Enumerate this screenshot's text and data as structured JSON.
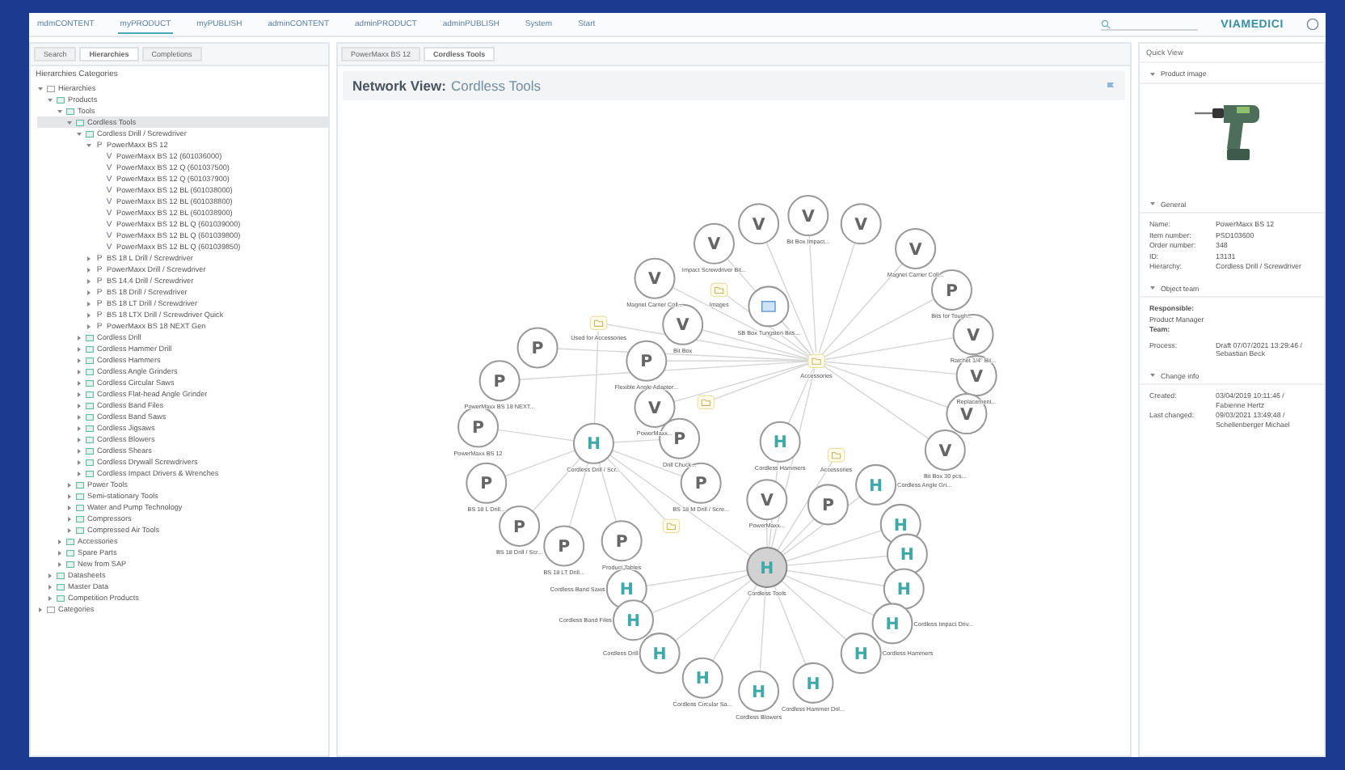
{
  "nav": {
    "items": [
      {
        "label": "mdmCONTENT",
        "selected": false
      },
      {
        "label": "myPRODUCT",
        "selected": true
      },
      {
        "label": "myPUBLISH",
        "selected": false
      },
      {
        "label": "adminCONTENT",
        "selected": false
      },
      {
        "label": "adminPRODUCT",
        "selected": false
      },
      {
        "label": "adminPUBLISH",
        "selected": false
      },
      {
        "label": "System",
        "selected": false
      },
      {
        "label": "Start",
        "selected": false
      }
    ],
    "logo": "VIAMEDICI"
  },
  "left_panel": {
    "tabs": [
      {
        "label": "Search",
        "selected": false
      },
      {
        "label": "Hierarchies",
        "selected": true
      },
      {
        "label": "Completions",
        "selected": false
      }
    ],
    "heading": "Hierarchies Categories",
    "tree": [
      {
        "label": "Hierarchies",
        "kind": "root",
        "expanded": true,
        "selected": false,
        "children": [
          {
            "label": "Products",
            "kind": "hierarchy",
            "expanded": true,
            "selected": false,
            "children": [
              {
                "label": "Tools",
                "kind": "hierarchy",
                "expanded": true,
                "selected": false,
                "children": [
                  {
                    "label": "Cordless Tools",
                    "kind": "hierarchy",
                    "expanded": true,
                    "selected": true,
                    "children": [
                      {
                        "label": "Cordless Drill / Screwdriver",
                        "kind": "hierarchy",
                        "expanded": true,
                        "selected": false,
                        "children": [
                          {
                            "label": "PowerMaxx BS 12",
                            "kind": "product",
                            "icon": "P",
                            "expanded": true,
                            "selected": false,
                            "children": [
                              {
                                "label": "PowerMaxx BS 12 (601036000)",
                                "kind": "variant",
                                "icon": "V",
                                "selected": false
                              },
                              {
                                "label": "PowerMaxx BS 12 Q (601037500)",
                                "kind": "variant",
                                "icon": "V",
                                "selected": false
                              },
                              {
                                "label": "PowerMaxx BS 12 Q (601037900)",
                                "kind": "variant",
                                "icon": "V",
                                "selected": false
                              },
                              {
                                "label": "PowerMaxx BS 12 BL (601038000)",
                                "kind": "variant",
                                "icon": "V",
                                "selected": false
                              },
                              {
                                "label": "PowerMaxx BS 12 BL (601038800)",
                                "kind": "variant",
                                "icon": "V",
                                "selected": false
                              },
                              {
                                "label": "PowerMaxx BS 12 BL (601038900)",
                                "kind": "variant",
                                "icon": "V",
                                "selected": false
                              },
                              {
                                "label": "PowerMaxx BS 12 BL Q (601039000)",
                                "kind": "variant",
                                "icon": "V",
                                "selected": false
                              },
                              {
                                "label": "PowerMaxx BS 12 BL Q (601039800)",
                                "kind": "variant",
                                "icon": "V",
                                "selected": false
                              },
                              {
                                "label": "PowerMaxx BS 12 BL Q (601039850)",
                                "kind": "variant",
                                "icon": "V",
                                "selected": false
                              }
                            ]
                          },
                          {
                            "label": "BS 18 L Drill / Screwdriver",
                            "kind": "product",
                            "icon": "P",
                            "expanded": false,
                            "selected": false
                          },
                          {
                            "label": "PowerMaxx Drill / Screwdriver",
                            "kind": "product",
                            "icon": "P",
                            "expanded": false,
                            "selected": false
                          },
                          {
                            "label": "BS 14.4 Drill / Screwdriver",
                            "kind": "product",
                            "icon": "P",
                            "expanded": false,
                            "selected": false
                          },
                          {
                            "label": "BS 18 Drill / Screwdriver",
                            "kind": "product",
                            "icon": "P",
                            "expanded": false,
                            "selected": false
                          },
                          {
                            "label": "BS 18 LT Drill / Screwdriver",
                            "kind": "product",
                            "icon": "P",
                            "expanded": false,
                            "selected": false
                          },
                          {
                            "label": "BS 18 LTX Drill / Screwdriver Quick",
                            "kind": "product",
                            "icon": "P",
                            "expanded": false,
                            "selected": false
                          },
                          {
                            "label": "PowerMaxx BS 18 NEXT Gen",
                            "kind": "product",
                            "icon": "P",
                            "expanded": false,
                            "selected": false
                          }
                        ]
                      },
                      {
                        "label": "Cordless Drill",
                        "kind": "hierarchy",
                        "expanded": false,
                        "selected": false
                      },
                      {
                        "label": "Cordless Hammer Drill",
                        "kind": "hierarchy",
                        "expanded": false,
                        "selected": false
                      },
                      {
                        "label": "Cordless Hammers",
                        "kind": "hierarchy",
                        "expanded": false,
                        "selected": false
                      },
                      {
                        "label": "Cordless Angle Grinders",
                        "kind": "hierarchy",
                        "expanded": false,
                        "selected": false
                      },
                      {
                        "label": "Cordless Circular Saws",
                        "kind": "hierarchy",
                        "expanded": false,
                        "selected": false
                      },
                      {
                        "label": "Cordless Flat-head Angle Grinder",
                        "kind": "hierarchy",
                        "expanded": false,
                        "selected": false
                      },
                      {
                        "label": "Cordless Band Files",
                        "kind": "hierarchy",
                        "expanded": false,
                        "selected": false
                      },
                      {
                        "label": "Cordless Band Saws",
                        "kind": "hierarchy",
                        "expanded": false,
                        "selected": false
                      },
                      {
                        "label": "Cordless Jigsaws",
                        "kind": "hierarchy",
                        "expanded": false,
                        "selected": false
                      },
                      {
                        "label": "Cordless Blowers",
                        "kind": "hierarchy",
                        "expanded": false,
                        "selected": false
                      },
                      {
                        "label": "Cordless Shears",
                        "kind": "hierarchy",
                        "expanded": false,
                        "selected": false
                      },
                      {
                        "label": "Cordless Drywall Screwdrivers",
                        "kind": "hierarchy",
                        "expanded": false,
                        "selected": false
                      },
                      {
                        "label": "Cordless Impact Drivers & Wrenches",
                        "kind": "hierarchy",
                        "expanded": false,
                        "selected": false
                      }
                    ]
                  },
                  {
                    "label": "Power Tools",
                    "kind": "hierarchy",
                    "expanded": false,
                    "selected": false
                  },
                  {
                    "label": "Semi-stationary Tools",
                    "kind": "hierarchy",
                    "expanded": false,
                    "selected": false
                  },
                  {
                    "label": "Water and Pump Technology",
                    "kind": "hierarchy",
                    "expanded": false,
                    "selected": false
                  },
                  {
                    "label": "Compressors",
                    "kind": "hierarchy",
                    "expanded": false,
                    "selected": false
                  },
                  {
                    "label": "Compressed Air Tools",
                    "kind": "hierarchy",
                    "expanded": false,
                    "selected": false
                  }
                ]
              },
              {
                "label": "Accessories",
                "kind": "hierarchy",
                "expanded": false,
                "selected": false
              },
              {
                "label": "Spare Parts",
                "kind": "hierarchy",
                "expanded": false,
                "selected": false
              },
              {
                "label": "New from SAP",
                "kind": "hierarchy",
                "expanded": false,
                "selected": false
              }
            ]
          },
          {
            "label": "Datasheets",
            "kind": "hierarchy",
            "expanded": false,
            "selected": false
          },
          {
            "label": "Master Data",
            "kind": "hierarchy",
            "expanded": false,
            "selected": false
          },
          {
            "label": "Competition Products",
            "kind": "hierarchy",
            "expanded": false,
            "selected": false
          }
        ]
      },
      {
        "label": "Categories",
        "kind": "root",
        "expanded": false,
        "selected": false
      }
    ]
  },
  "center_panel": {
    "tabs": [
      {
        "label": "PowerMaxx BS 12",
        "selected": false
      },
      {
        "label": "Cordless Tools",
        "selected": true
      }
    ],
    "title": "Network View:",
    "subject": "Cordless Tools",
    "nodes": [
      {
        "kind": "folder",
        "label": "Accessories",
        "selected": false
      },
      {
        "kind": "letter",
        "letter": "H",
        "label": "Cordless Drill / Scr...",
        "selected": false
      },
      {
        "kind": "letter",
        "letter": "H",
        "label": "Cordless Tools",
        "selected": true
      },
      {
        "kind": "letter",
        "letter": "V",
        "label": "Impact Screwdriver Bit...",
        "selected": false
      },
      {
        "kind": "letter",
        "letter": "V",
        "selected": false
      },
      {
        "kind": "letter",
        "letter": "V",
        "label": "Bit Box Impact...",
        "selected": false
      },
      {
        "kind": "letter",
        "letter": "V",
        "selected": false
      },
      {
        "kind": "letter",
        "letter": "V",
        "label": "Magnet Carrier Coll...",
        "selected": false
      },
      {
        "kind": "letter",
        "letter": "P",
        "label": "Bits for Tough...",
        "selected": false
      },
      {
        "kind": "letter",
        "letter": "V",
        "label": "Ratchet 1/4\" Bit...",
        "selected": false
      },
      {
        "kind": "letter",
        "letter": "V",
        "label": "Replacement...",
        "selected": false
      },
      {
        "kind": "letter",
        "letter": "V",
        "selected": false
      },
      {
        "kind": "letter",
        "letter": "V",
        "label": "Bit Box 30 pcs...",
        "selected": false
      },
      {
        "kind": "letter",
        "letter": "V",
        "label": "Magnet Carrier Coll...",
        "selected": false
      },
      {
        "kind": "letter",
        "letter": "V",
        "label": "Bit Box",
        "selected": false
      },
      {
        "kind": "image",
        "label": "SB Box Tungsten Bits...",
        "selected": false
      },
      {
        "kind": "folder",
        "label": "Images",
        "selected": false
      },
      {
        "kind": "folder",
        "label": "Used for Accessories",
        "selected": false
      },
      {
        "kind": "letter",
        "letter": "P",
        "label": "Flexible Angle Adapter...",
        "selected": false
      },
      {
        "kind": "letter",
        "letter": "V",
        "label": "PowerMaxx...",
        "selected": false
      },
      {
        "kind": "letter",
        "letter": "P",
        "selected": false
      },
      {
        "kind": "letter",
        "letter": "P",
        "label": "PowerMaxx BS 18 NEXT...",
        "selected": false
      },
      {
        "kind": "folder",
        "selected": false
      },
      {
        "kind": "letter",
        "letter": "P",
        "label": "PowerMaxx BS 12",
        "selected": false
      },
      {
        "kind": "letter",
        "letter": "P",
        "label": "BS 18 L Drill...",
        "selected": false
      },
      {
        "kind": "letter",
        "letter": "P",
        "label": "BS 18 Drill / Scr...",
        "selected": false
      },
      {
        "kind": "letter",
        "letter": "P",
        "label": "BS 18 LT Drill...",
        "selected": false
      },
      {
        "kind": "letter",
        "letter": "P",
        "label": "Drill Chuck...",
        "selected": false
      },
      {
        "kind": "letter",
        "letter": "P",
        "label": "BS 18 M Drill / Scre...",
        "selected": false
      },
      {
        "kind": "letter",
        "letter": "P",
        "label": "Product Tables",
        "selected": false
      },
      {
        "kind": "folder",
        "selected": false
      },
      {
        "kind": "letter",
        "letter": "H",
        "label": "Cordless Hammers",
        "selected": false
      },
      {
        "kind": "folder",
        "label": "Accessories",
        "selected": false
      },
      {
        "kind": "letter",
        "letter": "V",
        "label": "PowerMaxx...",
        "selected": false
      },
      {
        "kind": "letter",
        "letter": "P",
        "selected": false
      },
      {
        "kind": "letter",
        "letter": "H",
        "label": "Cordless Angle Gri...",
        "selected": false
      },
      {
        "kind": "letter",
        "letter": "H",
        "selected": false
      },
      {
        "kind": "letter",
        "letter": "H",
        "selected": false
      },
      {
        "kind": "letter",
        "letter": "H",
        "selected": false
      },
      {
        "kind": "letter",
        "letter": "H",
        "label": "Cordless Impact Driv...",
        "selected": false
      },
      {
        "kind": "letter",
        "letter": "H",
        "label": "Cordless Hammers",
        "selected": false
      },
      {
        "kind": "letter",
        "letter": "H",
        "label": "Cordless Hammer Dril...",
        "selected": false
      },
      {
        "kind": "letter",
        "letter": "H",
        "label": "Cordless Blowers",
        "selected": false
      },
      {
        "kind": "letter",
        "letter": "H",
        "label": "Cordless Circular Sa...",
        "selected": false
      },
      {
        "kind": "letter",
        "letter": "H",
        "label": "Cordless Drill",
        "selected": false
      },
      {
        "kind": "letter",
        "letter": "H",
        "label": "Cordless Band Saws",
        "selected": false
      },
      {
        "kind": "letter",
        "letter": "H",
        "label": "Cordless Band Files",
        "selected": false
      }
    ]
  },
  "quick_view": {
    "title": "Quick View",
    "sections": [
      {
        "kind": "image",
        "title": "Product image",
        "expanded": true
      },
      {
        "kind": "fields",
        "title": "General",
        "expanded": true,
        "fields": [
          {
            "label": "Name:",
            "value": "PowerMaxx BS 12"
          },
          {
            "label": "Item number:",
            "value": "PSD103600"
          },
          {
            "label": "Order number:",
            "value": "348"
          },
          {
            "label": "ID:",
            "value": "13131"
          },
          {
            "label": "Hierarchy:",
            "value": "Cordless Drill / Screwdriver"
          }
        ]
      },
      {
        "kind": "team",
        "title": "Object team",
        "expanded": true,
        "lines": [
          "Responsible:",
          "Product Manager",
          "Team:"
        ],
        "fields": [
          {
            "label": "Process:",
            "value": "Draft 07/07/2021 13:29:46 / Sebastian Beck"
          }
        ]
      },
      {
        "kind": "fields",
        "title": "Change info",
        "expanded": true,
        "fields": [
          {
            "label": "Created:",
            "value": "03/04/2019 10:11:46 / Fabienne Hertz"
          },
          {
            "label": "Last changed:",
            "value": "09/03/2021 13:49:48 / Schellenberger Michael"
          }
        ]
      }
    ]
  }
}
